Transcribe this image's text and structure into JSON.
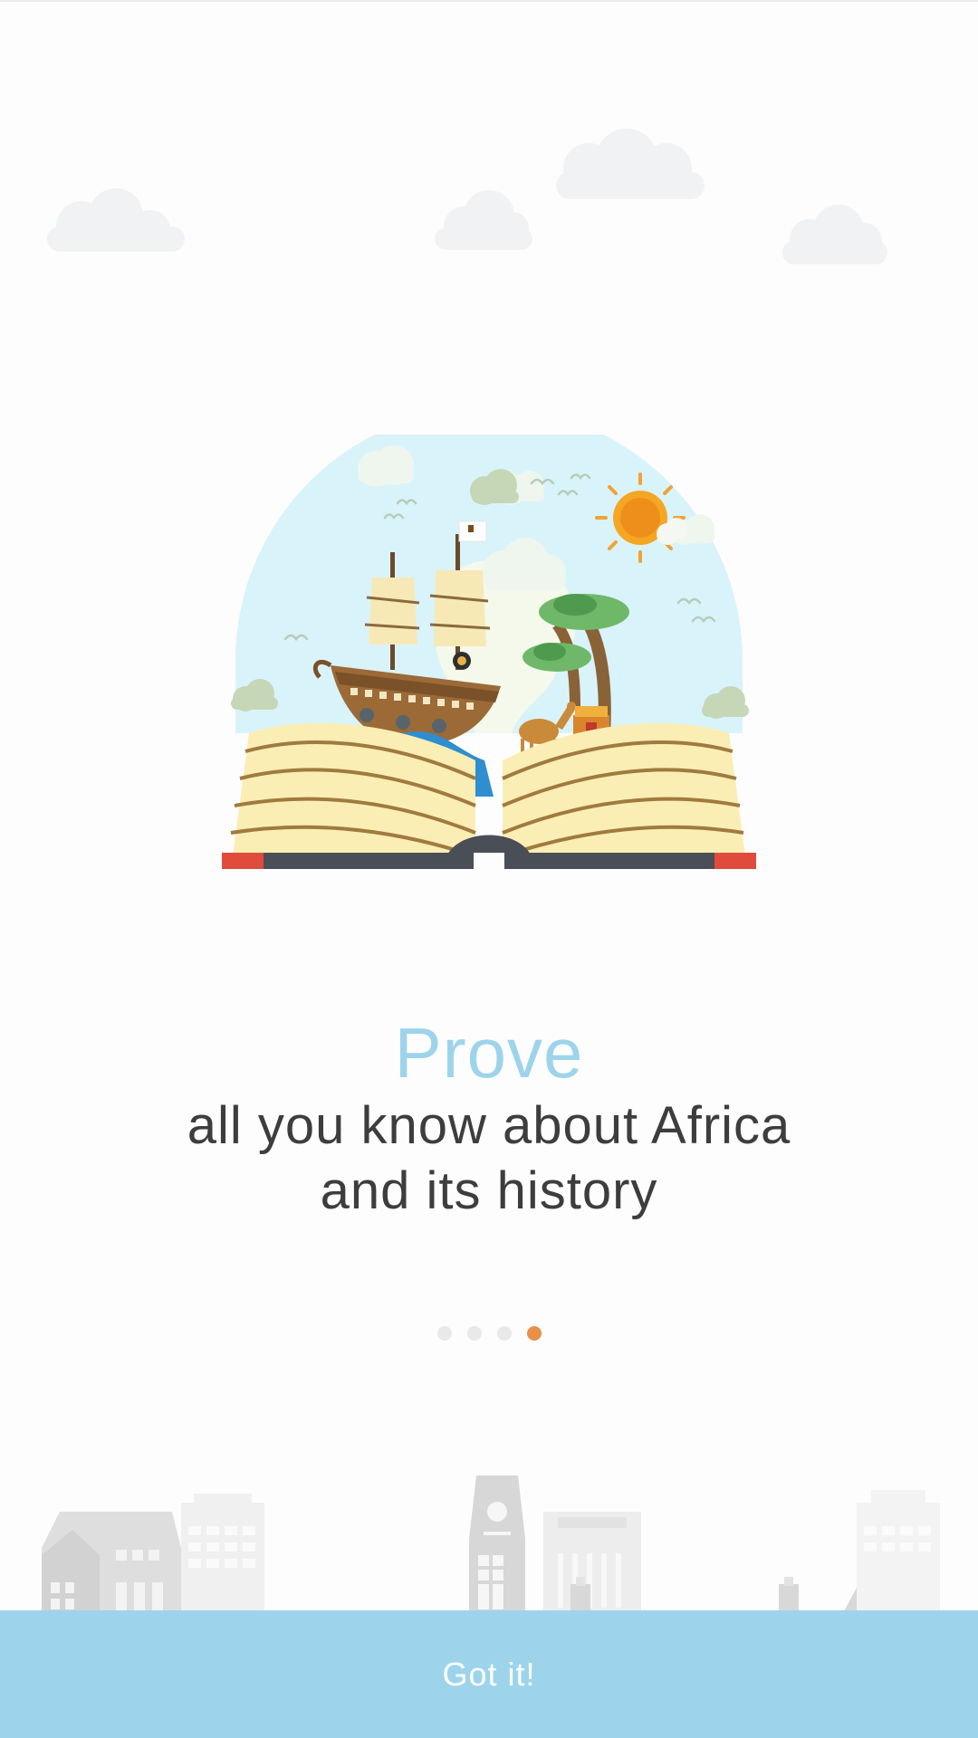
{
  "onboarding": {
    "headline_accent": "Prove",
    "headline_line1": "all you know about Africa",
    "headline_line2": "and its history"
  },
  "pager": {
    "total": 4,
    "current": 4,
    "active_color": "#e8904a",
    "inactive_color": "#e9e9ec"
  },
  "cta": {
    "label": "Got it!"
  },
  "colors": {
    "accent": "#9dd4ec",
    "text": "#3d3d3d",
    "background": "#fdfdfd"
  }
}
